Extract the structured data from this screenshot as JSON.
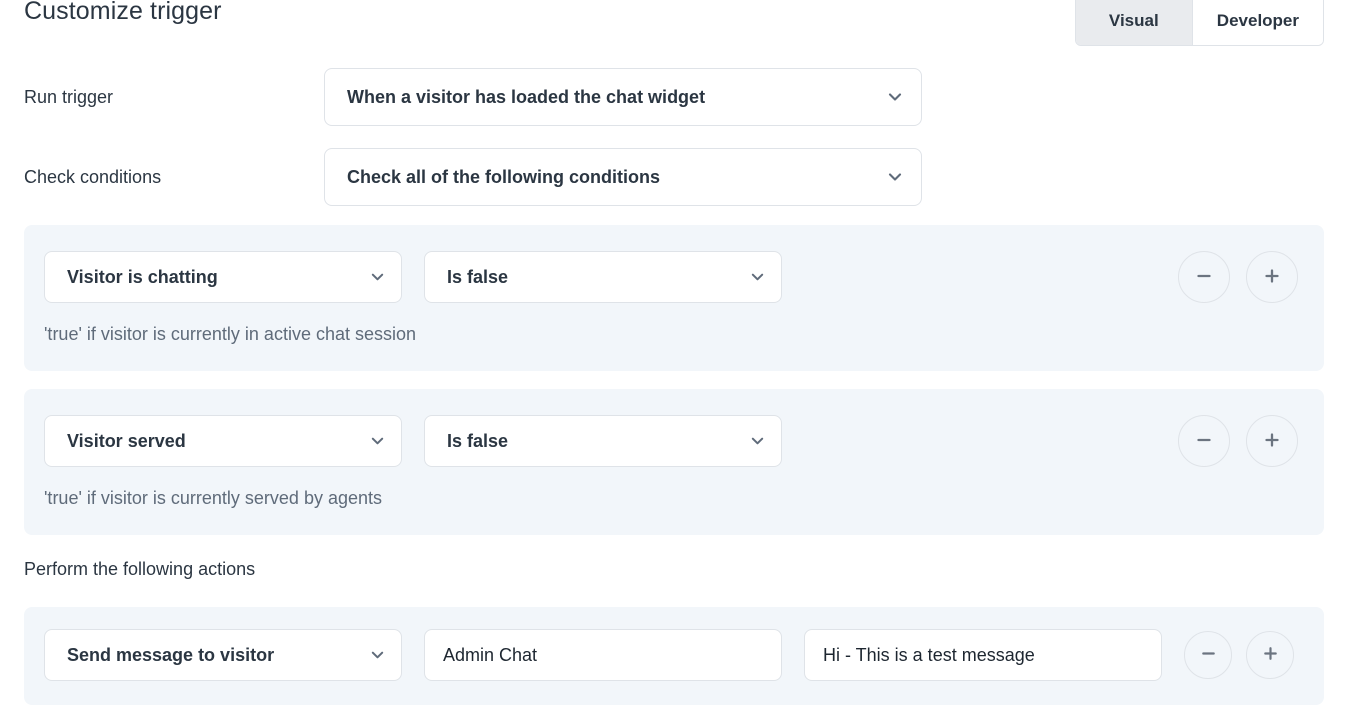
{
  "header": {
    "title": "Customize trigger",
    "tabs": [
      {
        "label": "Visual",
        "active": true
      },
      {
        "label": "Developer",
        "active": false
      }
    ]
  },
  "form": {
    "run_trigger": {
      "label": "Run trigger",
      "value": "When a visitor has loaded the chat widget",
      "chevron_icon": "chevron-down-icon"
    },
    "check_conditions": {
      "label": "Check conditions",
      "value": "Check all of the following conditions",
      "chevron_icon": "chevron-down-icon"
    }
  },
  "conditions": [
    {
      "attribute": "Visitor is chatting",
      "operator": "Is false",
      "help": "'true' if visitor is currently in active chat session",
      "remove_icon": "minus-icon",
      "add_icon": "plus-icon"
    },
    {
      "attribute": "Visitor served",
      "operator": "Is false",
      "help": "'true' if visitor is currently served by agents",
      "remove_icon": "minus-icon",
      "add_icon": "plus-icon"
    }
  ],
  "actions_section": {
    "label": "Perform the following actions",
    "rows": [
      {
        "action": "Send message to visitor",
        "recipient_value": "Admin Chat",
        "message_value": "Hi - This is a test message",
        "remove_icon": "minus-icon",
        "add_icon": "plus-icon"
      }
    ]
  },
  "colors": {
    "panel_background": "#f2f6fa",
    "text_primary": "#2b3642",
    "text_muted": "#5f6b7a",
    "border": "#dfe3e8",
    "tab_active_background": "#e9ebee"
  }
}
